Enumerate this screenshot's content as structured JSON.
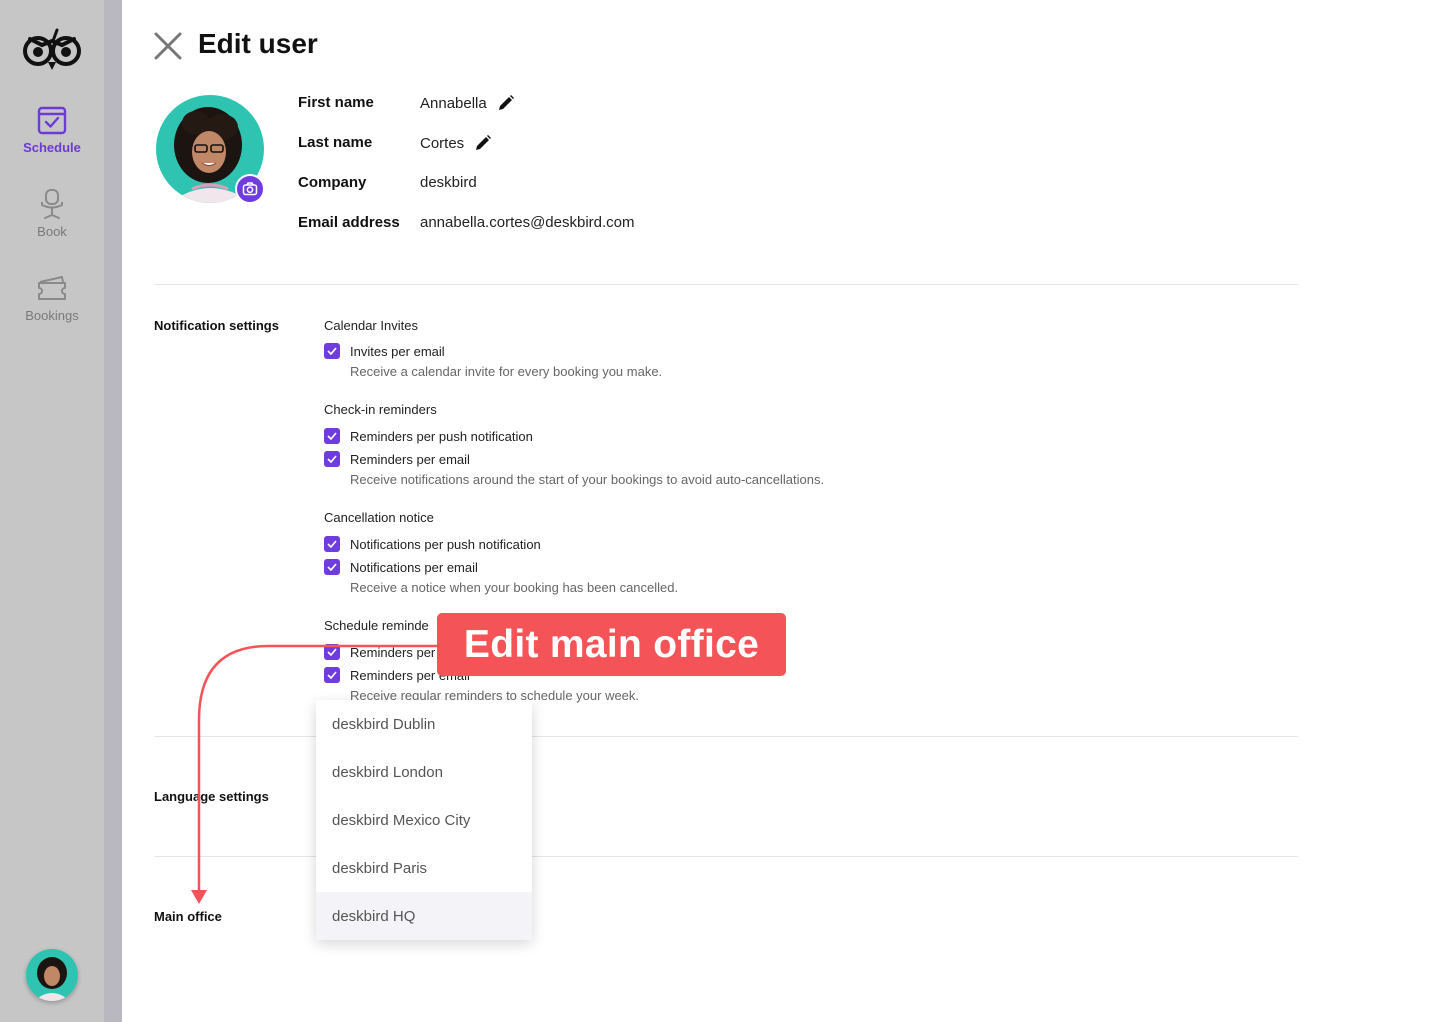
{
  "sidebar": {
    "items": [
      {
        "label": "Schedule",
        "icon": "calendar-check-icon",
        "active": true
      },
      {
        "label": "Book",
        "icon": "office-chair-icon",
        "active": false
      },
      {
        "label": "Bookings",
        "icon": "tickets-icon",
        "active": false
      }
    ],
    "accent_color": "#6c3ad6"
  },
  "header": {
    "title": "Edit user",
    "close_icon": "close-icon"
  },
  "profile": {
    "fields": [
      {
        "label": "First name",
        "value": "Annabella",
        "editable": true
      },
      {
        "label": "Last name",
        "value": "Cortes",
        "editable": true
      },
      {
        "label": "Company",
        "value": "deskbird",
        "editable": false
      },
      {
        "label": "Email address",
        "value": "annabella.cortes@deskbird.com",
        "editable": false
      }
    ]
  },
  "notifications": {
    "section_label": "Notification settings",
    "groups": [
      {
        "title": "Calendar Invites",
        "options": [
          "Invites per email"
        ],
        "help": "Receive a calendar invite for every booking you make."
      },
      {
        "title": "Check-in reminders",
        "options": [
          "Reminders per push notification",
          "Reminders per email"
        ],
        "help": "Receive notifications around the start of your bookings to avoid auto-cancellations."
      },
      {
        "title": "Cancellation notice",
        "options": [
          "Notifications per push notification",
          "Notifications per email"
        ],
        "help": "Receive a notice when your booking has been cancelled."
      },
      {
        "title": "Schedule reminde",
        "options": [
          "Reminders per",
          "Reminders per email"
        ],
        "help": "Receive regular reminders to schedule your week."
      }
    ]
  },
  "language": {
    "section_label": "Language settings"
  },
  "main_office": {
    "section_label": "Main office",
    "options": [
      "deskbird Dublin",
      "deskbird London",
      "deskbird Mexico City",
      "deskbird Paris",
      "deskbird HQ"
    ],
    "selected": "deskbird HQ"
  },
  "callout": {
    "text": "Edit main office",
    "color": "#f45358"
  }
}
